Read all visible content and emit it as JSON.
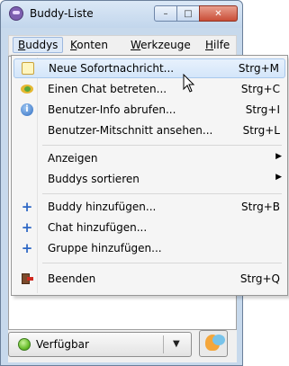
{
  "window": {
    "title": "Buddy-Liste",
    "controls": {
      "minimize": "–",
      "maximize": "□",
      "close": "✕"
    }
  },
  "menubar": {
    "items": [
      {
        "label": "Buddys",
        "mnemonic": "B",
        "rest": "uddys"
      },
      {
        "label": "Konten",
        "mnemonic": "K",
        "rest": "onten"
      },
      {
        "label": "Werkzeuge",
        "mnemonic": "W",
        "rest": "erkzeuge"
      },
      {
        "label": "Hilfe",
        "mnemonic": "H",
        "rest": "ilfe"
      }
    ]
  },
  "menu": {
    "items": [
      {
        "label": "Neue Sofortnachricht...",
        "shortcut": "Strg+M",
        "icon": "note-icon",
        "highlighted": true
      },
      {
        "label": "Einen Chat betreten...",
        "shortcut": "Strg+C",
        "icon": "chat-icon"
      },
      {
        "label": "Benutzer-Info abrufen...",
        "shortcut": "Strg+I",
        "icon": "info-icon"
      },
      {
        "label": "Benutzer-Mitschnitt ansehen...",
        "shortcut": "Strg+L",
        "icon": ""
      },
      {
        "label": "Anzeigen",
        "shortcut": "",
        "icon": "",
        "submenu": true
      },
      {
        "label": "Buddys sortieren",
        "shortcut": "",
        "icon": "",
        "submenu": true
      },
      {
        "label": "Buddy hinzufügen...",
        "shortcut": "Strg+B",
        "icon": "plus-icon"
      },
      {
        "label": "Chat hinzufügen...",
        "shortcut": "",
        "icon": "plus-icon"
      },
      {
        "label": "Gruppe hinzufügen...",
        "shortcut": "",
        "icon": "plus-icon"
      },
      {
        "label": "Beenden",
        "shortcut": "Strg+Q",
        "icon": "exit-icon"
      }
    ]
  },
  "status": {
    "label": "Verfügbar",
    "arrow": "▼"
  }
}
